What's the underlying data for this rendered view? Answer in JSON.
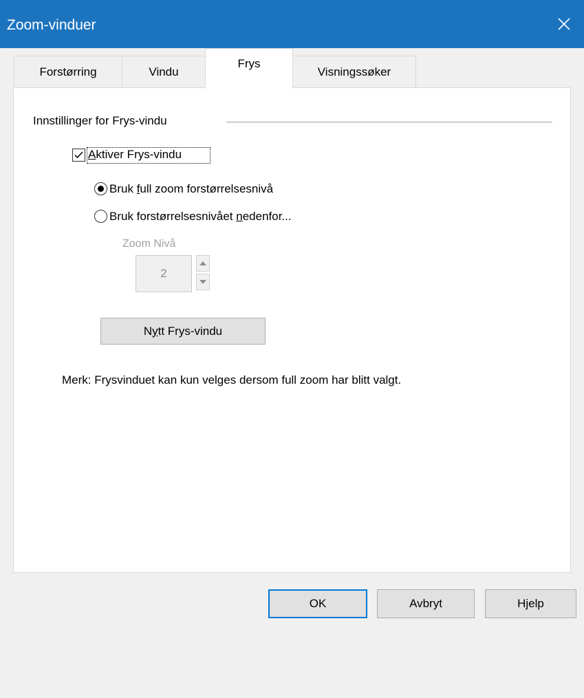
{
  "window": {
    "title": "Zoom-vinduer"
  },
  "tabs": [
    {
      "label": "Forstørring",
      "selected": false
    },
    {
      "label": "Vindu",
      "selected": false
    },
    {
      "label": "Frys",
      "selected": true
    },
    {
      "label": "Visningssøker",
      "selected": false
    }
  ],
  "group": {
    "label": "Innstillinger for Frys-vindu"
  },
  "enable_checkbox": {
    "accel": "A",
    "rest": "ktiver Frys-vindu",
    "checked": true
  },
  "radio_full": {
    "pre": "Bruk ",
    "accel": "f",
    "post": "ull zoom forstørrelsesnivå",
    "selected": true
  },
  "radio_below": {
    "pre": "Bruk forstørrelsesnivået ",
    "accel": "n",
    "post": "edenfor...",
    "selected": false
  },
  "zoom_level": {
    "label": "Zoom Nivå",
    "value": "2",
    "enabled": false
  },
  "new_freeze_button": {
    "pre": "N",
    "accel": "y",
    "post": "tt Frys-vindu"
  },
  "note": "Merk: Frysvinduet kan kun velges dersom full zoom har blitt valgt.",
  "footer": {
    "ok": "OK",
    "cancel": "Avbryt",
    "help": "Hjelp"
  },
  "colors": {
    "titlebar": "#1c74bf",
    "default_button_border": "#0078d7",
    "disabled_text": "#a0a0a0"
  }
}
